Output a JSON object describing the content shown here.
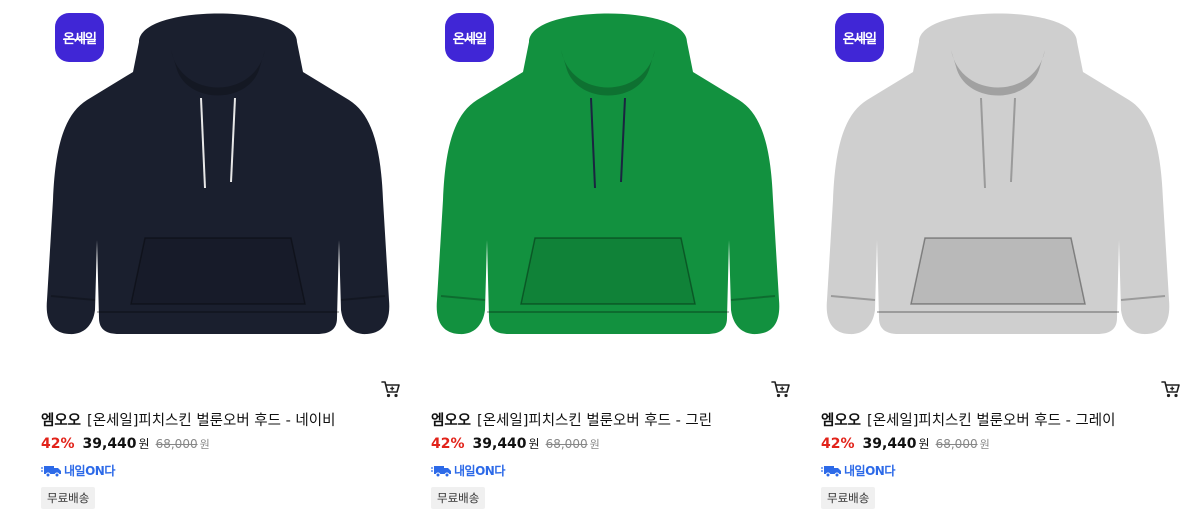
{
  "colors": {
    "badge": "#4026d6",
    "discount": "#e2231a",
    "delivery": "#2d6ae8"
  },
  "products": [
    {
      "badge": "온세일",
      "brand": "엠오오",
      "name": "[온세일]피치스킨 벌룬오버 후드 - 네이비",
      "discount": "42%",
      "price": "39,440",
      "price_unit": "원",
      "original_price": "68,000",
      "original_unit": "원",
      "delivery": "내일ON다",
      "shipping": "무료배송",
      "color": "#1a1f2e",
      "image_icon": "hoodie-navy"
    },
    {
      "badge": "온세일",
      "brand": "엠오오",
      "name": "[온세일]피치스킨 벌룬오버 후드 - 그린",
      "discount": "42%",
      "price": "39,440",
      "price_unit": "원",
      "original_price": "68,000",
      "original_unit": "원",
      "delivery": "내일ON다",
      "shipping": "무료배송",
      "color": "#12913f",
      "image_icon": "hoodie-green"
    },
    {
      "badge": "온세일",
      "brand": "엠오오",
      "name": "[온세일]피치스킨 벌룬오버 후드 - 그레이",
      "discount": "42%",
      "price": "39,440",
      "price_unit": "원",
      "original_price": "68,000",
      "original_unit": "원",
      "delivery": "내일ON다",
      "shipping": "무료배송",
      "color": "#cfcfcf",
      "image_icon": "hoodie-gray"
    }
  ]
}
